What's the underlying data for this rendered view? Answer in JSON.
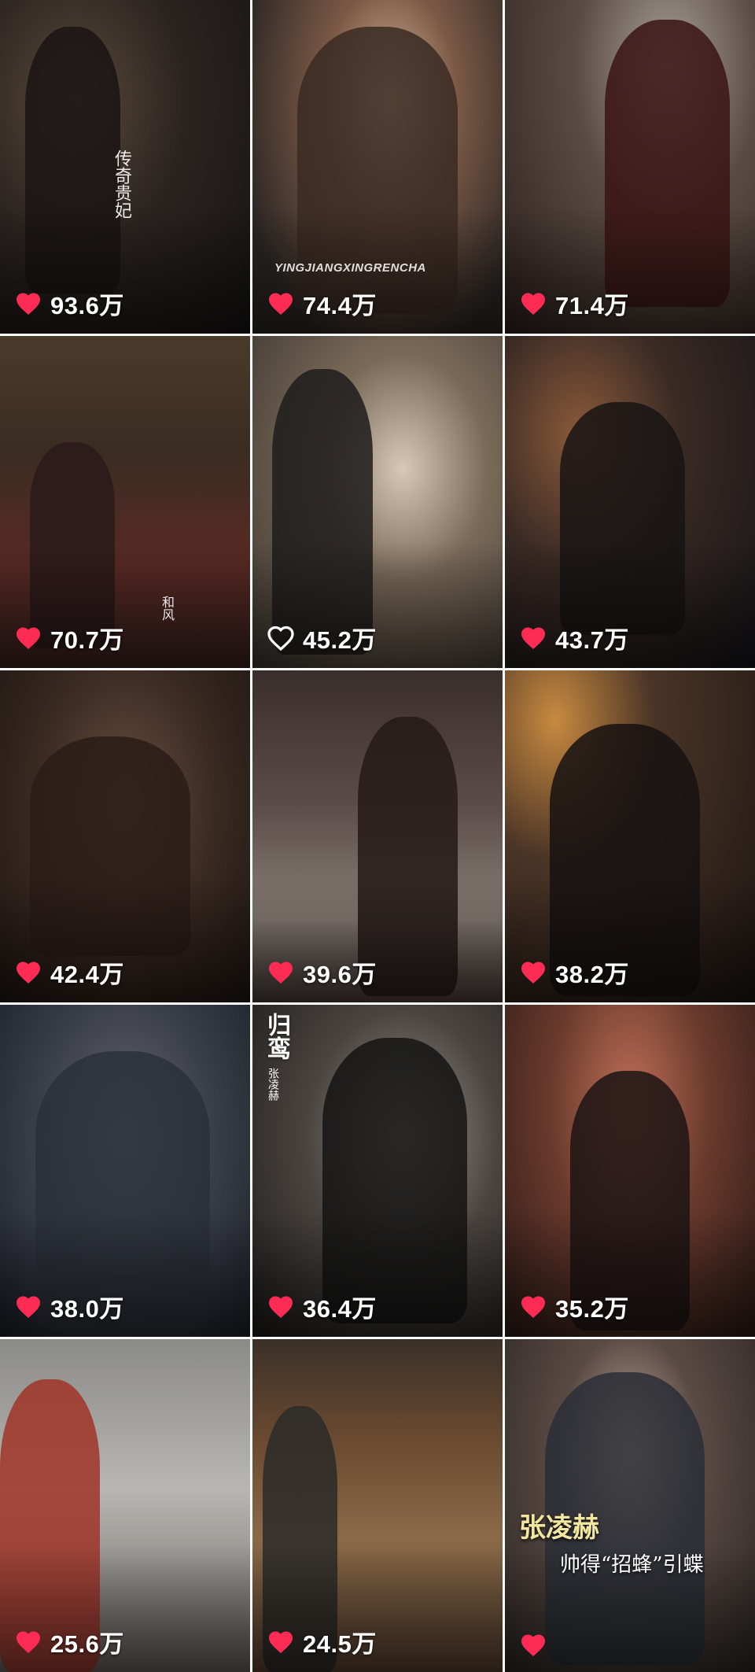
{
  "colors": {
    "heart_filled": "#fe2c55",
    "heart_outline": "#ffffff",
    "count_text": "#ffffff",
    "caption_gold": "#f3e7a0",
    "divider": "#ffffff"
  },
  "tiles": [
    {
      "likes": "93.6万",
      "liked": true,
      "overlay": "传奇贵妃",
      "watermark": ""
    },
    {
      "likes": "74.4万",
      "liked": true,
      "overlay": "",
      "watermark": "YINGJIANGXINGRENCHA"
    },
    {
      "likes": "71.4万",
      "liked": true,
      "overlay": "",
      "watermark": ""
    },
    {
      "likes": "70.7万",
      "liked": true,
      "overlay": "和风",
      "watermark": ""
    },
    {
      "likes": "45.2万",
      "liked": false,
      "overlay": "",
      "watermark": ""
    },
    {
      "likes": "43.7万",
      "liked": true,
      "overlay": "",
      "watermark": ""
    },
    {
      "likes": "42.4万",
      "liked": true,
      "overlay": "",
      "watermark": ""
    },
    {
      "likes": "39.6万",
      "liked": true,
      "overlay": "",
      "watermark": ""
    },
    {
      "likes": "38.2万",
      "liked": true,
      "overlay": "",
      "watermark": ""
    },
    {
      "likes": "38.0万",
      "liked": true,
      "overlay": "",
      "watermark": ""
    },
    {
      "likes": "36.4万",
      "liked": true,
      "overlay": "",
      "watermark": ""
    },
    {
      "likes": "35.2万",
      "liked": true,
      "overlay": "",
      "watermark": ""
    },
    {
      "likes": "25.6万",
      "liked": true,
      "overlay": "",
      "watermark": ""
    },
    {
      "likes": "24.5万",
      "liked": true,
      "overlay": "",
      "watermark": ""
    },
    {
      "likes": "",
      "liked": true,
      "overlay": "",
      "watermark": ""
    }
  ],
  "captions": {
    "tile11_title": "归鸾",
    "tile11_subtitle": "张凌赫",
    "tile15_name": "张凌赫",
    "tile15_slogan": "帅得“招蜂”引蝶"
  }
}
